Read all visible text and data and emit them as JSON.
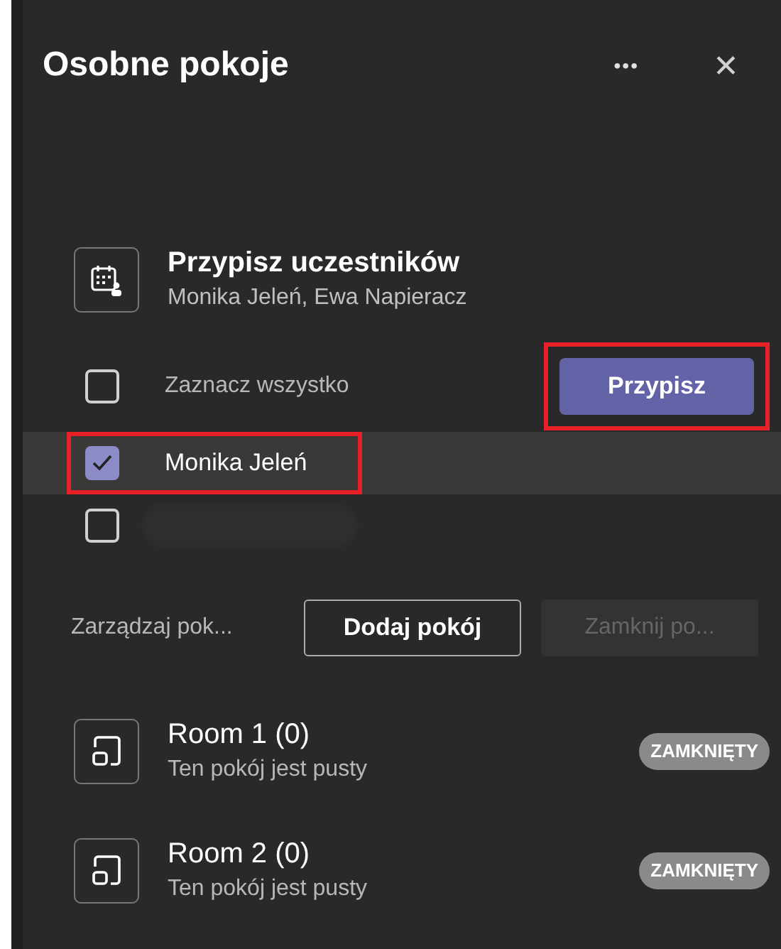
{
  "panel": {
    "title": "Osobne pokoje",
    "more": "•••",
    "close": "✕"
  },
  "assign": {
    "title": "Przypisz uczestników",
    "subtitle": "Monika Jeleń, Ewa Napieracz",
    "select_all": {
      "label": "Zaznacz wszystko",
      "checked": false
    },
    "button": {
      "label": "Przypisz",
      "highlighted": true
    },
    "participants": [
      {
        "kind": "named",
        "name": "Monika Jeleń",
        "checked": true,
        "highlighted": true
      },
      {
        "kind": "redacted",
        "checked": false,
        "highlighted": false
      }
    ]
  },
  "manage": {
    "label": "Zarządzaj pok...",
    "buttons": [
      {
        "label": "Dodaj pokój",
        "disabled": false
      },
      {
        "label": "Zamknij po...",
        "disabled": true
      }
    ]
  },
  "rooms": [
    {
      "name": "Room 1 (0)",
      "status": "Ten pokój jest pusty",
      "badge": "ZAMKNIĘTY"
    },
    {
      "name": "Room 2 (0)",
      "status": "Ten pokój jest pusty",
      "badge": "ZAMKNIĘTY"
    }
  ]
}
